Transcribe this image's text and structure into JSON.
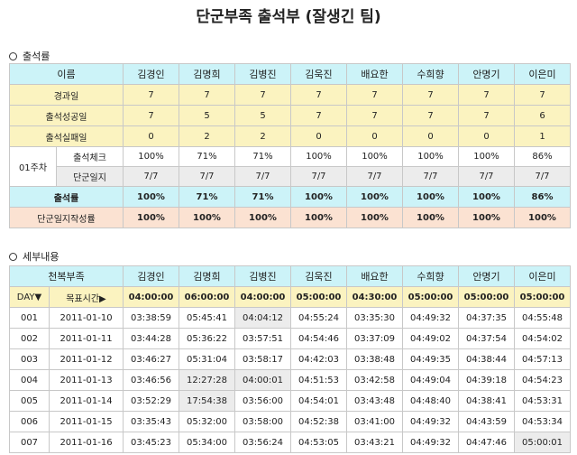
{
  "title": "단군부족 출석부 (잘생긴 팀)",
  "section1": "출석률",
  "section2": "세부내용",
  "names": [
    "김경인",
    "김명희",
    "김병진",
    "김욱진",
    "배요한",
    "수희향",
    "안명기",
    "이은미"
  ],
  "attendance": {
    "name_header": "이름",
    "rows": [
      {
        "label": "경과일",
        "values": [
          "7",
          "7",
          "7",
          "7",
          "7",
          "7",
          "7",
          "7"
        ]
      },
      {
        "label": "출석성공일",
        "values": [
          "7",
          "5",
          "5",
          "7",
          "7",
          "7",
          "7",
          "6"
        ]
      },
      {
        "label": "출석실패일",
        "values": [
          "0",
          "2",
          "2",
          "0",
          "0",
          "0",
          "0",
          "1"
        ]
      }
    ],
    "week_label": "01주차",
    "week_rows": [
      {
        "label": "출석체크",
        "values": [
          "100%",
          "71%",
          "71%",
          "100%",
          "100%",
          "100%",
          "100%",
          "86%"
        ]
      },
      {
        "label": "단군일지",
        "values": [
          "7/7",
          "7/7",
          "7/7",
          "7/7",
          "7/7",
          "7/7",
          "7/7",
          "7/7"
        ]
      }
    ],
    "rate_row": {
      "label": "출석률",
      "values": [
        "100%",
        "71%",
        "71%",
        "100%",
        "100%",
        "100%",
        "100%",
        "86%"
      ]
    },
    "journal_row": {
      "label": "단군일지작성률",
      "values": [
        "100%",
        "100%",
        "100%",
        "100%",
        "100%",
        "100%",
        "100%",
        "100%"
      ]
    }
  },
  "details": {
    "tribe_header": "천복부족",
    "day_header": "DAY▼",
    "target_header": "목표시간▶",
    "targets": [
      "04:00:00",
      "06:00:00",
      "04:00:00",
      "05:00:00",
      "04:30:00",
      "05:00:00",
      "05:00:00",
      "05:00:00"
    ],
    "rows": [
      {
        "day": "001",
        "date": "2011-01-10",
        "times": [
          "03:38:59",
          "05:45:41",
          "04:04:12",
          "04:55:24",
          "03:35:30",
          "04:49:32",
          "04:37:35",
          "04:55:48"
        ]
      },
      {
        "day": "002",
        "date": "2011-01-11",
        "times": [
          "03:44:28",
          "05:36:22",
          "03:57:51",
          "04:54:46",
          "03:37:09",
          "04:49:02",
          "04:37:54",
          "04:54:02"
        ]
      },
      {
        "day": "003",
        "date": "2011-01-12",
        "times": [
          "03:46:27",
          "05:31:04",
          "03:58:17",
          "04:42:03",
          "03:38:48",
          "04:49:35",
          "04:38:44",
          "04:57:13"
        ]
      },
      {
        "day": "004",
        "date": "2011-01-13",
        "times": [
          "03:46:56",
          "12:27:28",
          "04:00:01",
          "04:51:53",
          "03:42:58",
          "04:49:04",
          "04:39:18",
          "04:54:23"
        ]
      },
      {
        "day": "005",
        "date": "2011-01-14",
        "times": [
          "03:52:29",
          "17:54:38",
          "03:56:00",
          "04:54:01",
          "03:43:48",
          "04:48:40",
          "04:38:41",
          "04:53:31"
        ]
      },
      {
        "day": "006",
        "date": "2011-01-15",
        "times": [
          "03:35:43",
          "05:32:00",
          "03:58:00",
          "04:52:38",
          "03:41:00",
          "04:49:32",
          "04:43:59",
          "04:53:34"
        ]
      },
      {
        "day": "007",
        "date": "2011-01-16",
        "times": [
          "03:45:23",
          "05:34:00",
          "03:56:24",
          "04:53:05",
          "03:43:21",
          "04:49:32",
          "04:47:46",
          "05:00:01"
        ]
      }
    ]
  }
}
